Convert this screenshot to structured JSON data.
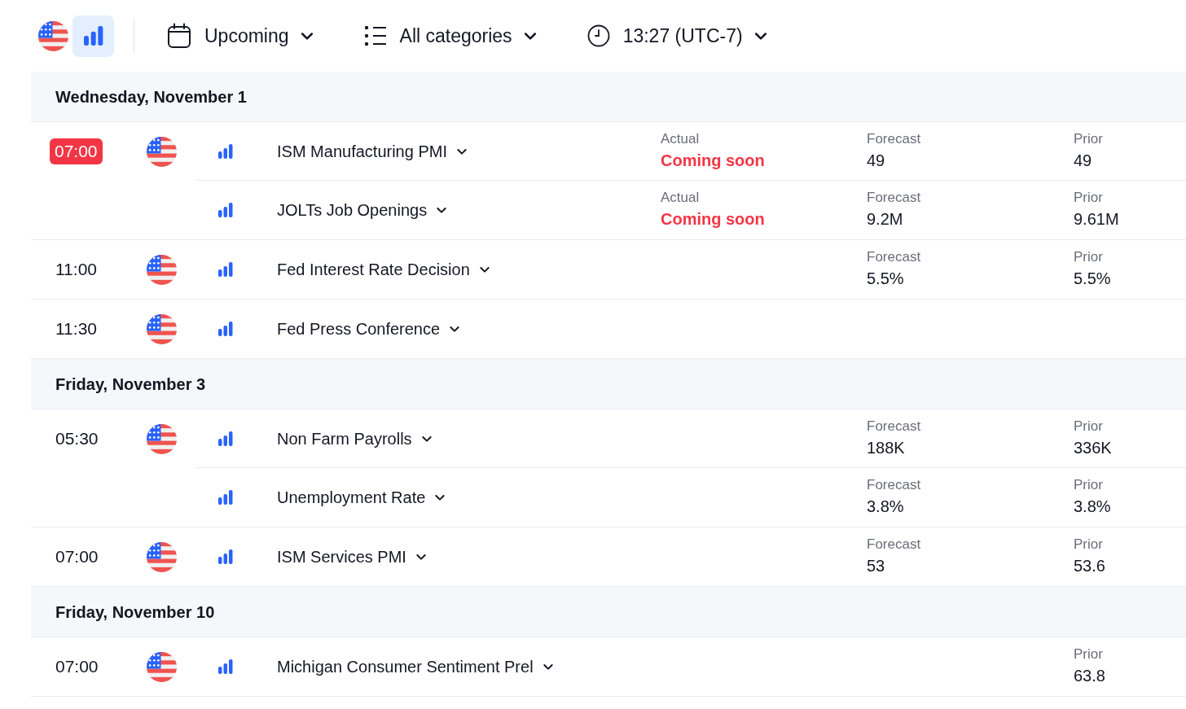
{
  "toolbar": {
    "view_buttons": [
      {
        "kind": "flag",
        "selected": false
      },
      {
        "kind": "chart",
        "selected": true
      }
    ],
    "filters": [
      {
        "kind": "calendar",
        "label": "Upcoming"
      },
      {
        "kind": "list",
        "label": "All categories"
      },
      {
        "kind": "clock",
        "label": "13:27 (UTC-7)"
      }
    ]
  },
  "days": [
    {
      "date": "Wednesday, November 1",
      "groups": [
        {
          "time": "07:00",
          "highlighted": true,
          "events": [
            {
              "name": "ISM Manufacturing PMI",
              "actual": {
                "label": "Actual",
                "value": "Coming soon"
              },
              "forecast": {
                "label": "Forecast",
                "value": "49"
              },
              "prior": {
                "label": "Prior",
                "value": "49"
              }
            },
            {
              "name": "JOLTs Job Openings",
              "actual": {
                "label": "Actual",
                "value": "Coming soon"
              },
              "forecast": {
                "label": "Forecast",
                "value": "9.2M"
              },
              "prior": {
                "label": "Prior",
                "value": "9.61M"
              }
            }
          ]
        },
        {
          "time": "11:00",
          "highlighted": false,
          "events": [
            {
              "name": "Fed Interest Rate Decision",
              "forecast": {
                "label": "Forecast",
                "value": "5.5%"
              },
              "prior": {
                "label": "Prior",
                "value": "5.5%"
              }
            }
          ]
        },
        {
          "time": "11:30",
          "highlighted": false,
          "events": [
            {
              "name": "Fed Press Conference"
            }
          ]
        }
      ]
    },
    {
      "date": "Friday, November 3",
      "groups": [
        {
          "time": "05:30",
          "highlighted": false,
          "events": [
            {
              "name": "Non Farm Payrolls",
              "forecast": {
                "label": "Forecast",
                "value": "188K"
              },
              "prior": {
                "label": "Prior",
                "value": "336K"
              }
            },
            {
              "name": "Unemployment Rate",
              "forecast": {
                "label": "Forecast",
                "value": "3.8%"
              },
              "prior": {
                "label": "Prior",
                "value": "3.8%"
              }
            }
          ]
        },
        {
          "time": "07:00",
          "highlighted": false,
          "events": [
            {
              "name": "ISM Services PMI",
              "forecast": {
                "label": "Forecast",
                "value": "53"
              },
              "prior": {
                "label": "Prior",
                "value": "53.6"
              }
            }
          ]
        }
      ]
    },
    {
      "date": "Friday, November 10",
      "groups": [
        {
          "time": "07:00",
          "highlighted": false,
          "events": [
            {
              "name": "Michigan Consumer Sentiment Prel",
              "prior": {
                "label": "Prior",
                "value": "63.8"
              }
            }
          ]
        }
      ]
    }
  ]
}
